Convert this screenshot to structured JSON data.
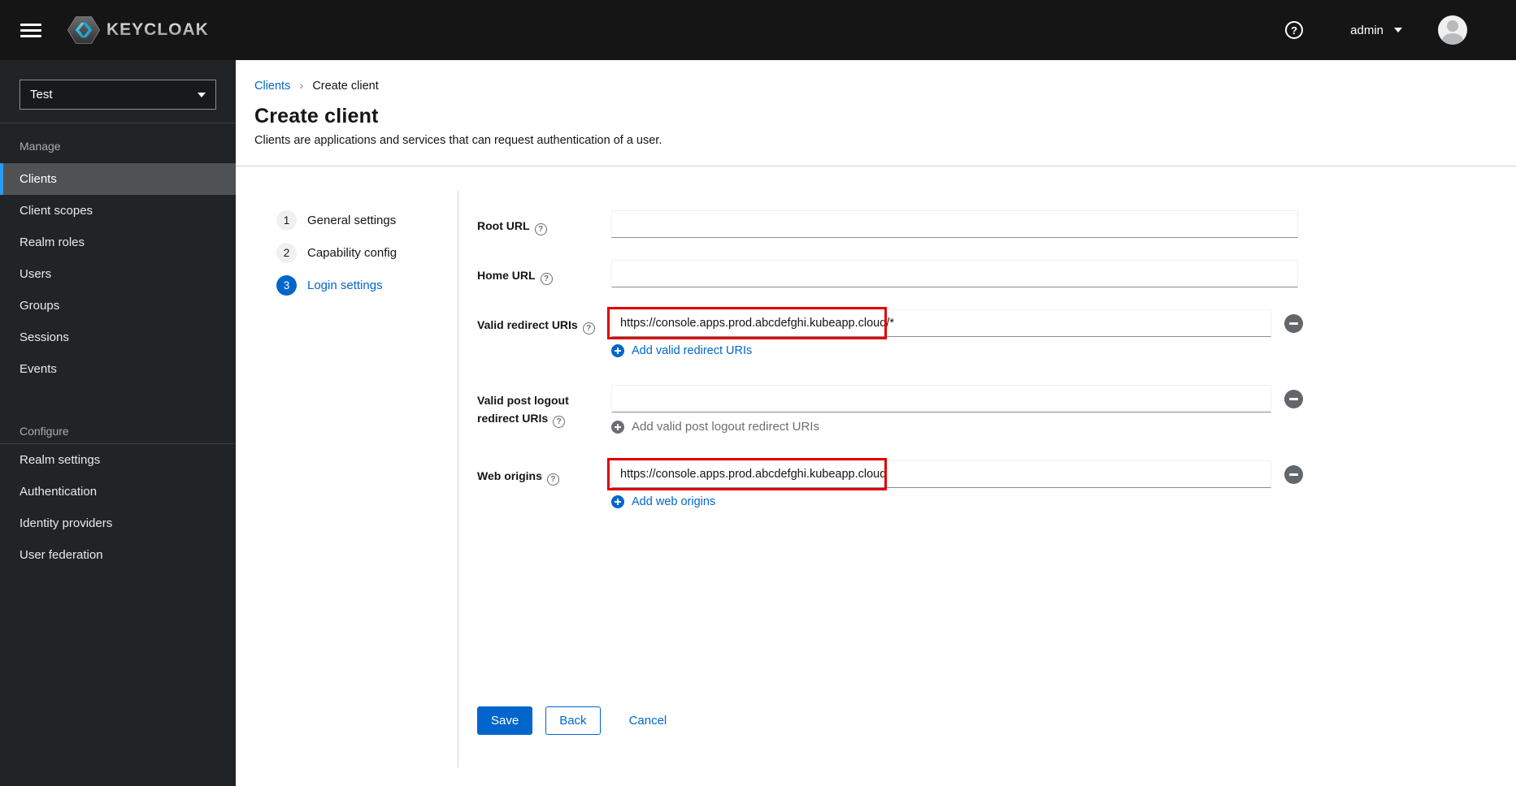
{
  "masthead": {
    "brand_text": "KEYCLOAK",
    "username": "admin"
  },
  "sidebar": {
    "realm_selector": {
      "value": "Test"
    },
    "sections": [
      {
        "label": "Manage",
        "items": [
          {
            "label": "Clients",
            "active": true
          },
          {
            "label": "Client scopes",
            "active": false
          },
          {
            "label": "Realm roles",
            "active": false
          },
          {
            "label": "Users",
            "active": false
          },
          {
            "label": "Groups",
            "active": false
          },
          {
            "label": "Sessions",
            "active": false
          },
          {
            "label": "Events",
            "active": false
          }
        ]
      },
      {
        "label": "Configure",
        "items": [
          {
            "label": "Realm settings",
            "active": false
          },
          {
            "label": "Authentication",
            "active": false
          },
          {
            "label": "Identity providers",
            "active": false
          },
          {
            "label": "User federation",
            "active": false
          }
        ]
      }
    ]
  },
  "breadcrumb": {
    "parent": "Clients",
    "current": "Create client"
  },
  "page_header": {
    "title": "Create client",
    "description": "Clients are applications and services that can request authentication of a user."
  },
  "wizard": {
    "steps": [
      {
        "number": "1",
        "label": "General settings",
        "state": "visited"
      },
      {
        "number": "2",
        "label": "Capability config",
        "state": "visited"
      },
      {
        "number": "3",
        "label": "Login settings",
        "state": "current"
      }
    ]
  },
  "form": {
    "root_url": {
      "label": "Root URL",
      "value": ""
    },
    "home_url": {
      "label": "Home URL",
      "value": ""
    },
    "valid_redirect_uris": {
      "label": "Valid redirect URIs",
      "value": "https://console.apps.prod.abcdefghi.kubeapp.cloud/*",
      "add_button": "Add valid redirect URIs",
      "highlighted": true
    },
    "valid_post_logout_redirect_uris": {
      "label": "Valid post logout redirect URIs",
      "value": "",
      "add_button": "Add valid post logout redirect URIs",
      "highlighted": false
    },
    "web_origins": {
      "label": "Web origins",
      "value": "https://console.apps.prod.abcdefghi.kubeapp.cloud",
      "add_button": "Add web origins",
      "highlighted": true
    }
  },
  "actions": {
    "save": "Save",
    "back": "Back",
    "cancel": "Cancel"
  },
  "icons": {
    "nav_toggle": "hamburger-icon",
    "help": "question-circle-icon",
    "user_dropdown": "chevron-down-icon",
    "add": "plus-circle-icon",
    "remove": "minus-circle-icon"
  },
  "colors": {
    "primary_blue": "#0066cc",
    "annotation_red": "#e00000",
    "masthead_bg": "#151515",
    "sidebar_bg": "#212427",
    "active_nav_bg": "#4f5255",
    "active_nav_indicator": "#2b9af3",
    "muted_gray": "#6a6e73",
    "divider_gray": "#d2d2d2"
  }
}
